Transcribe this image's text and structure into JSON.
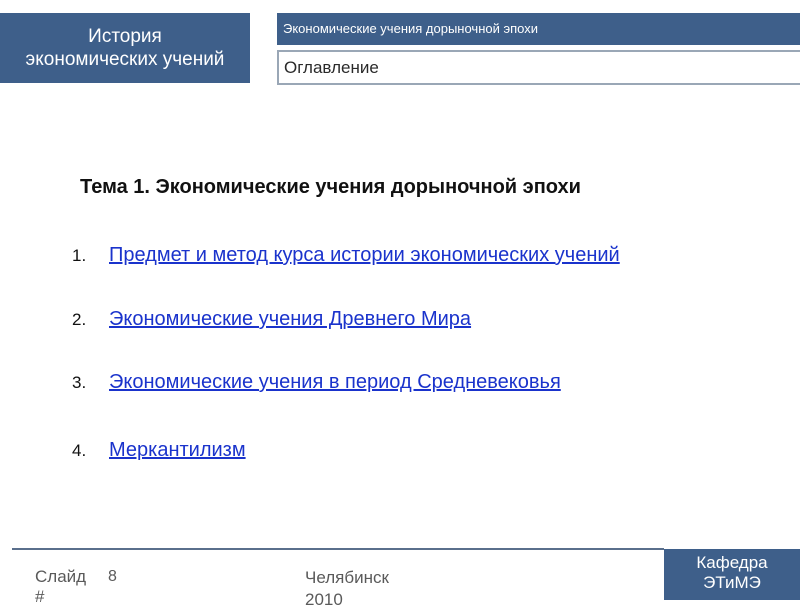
{
  "header": {
    "course_title_line1": "История",
    "course_title_line2": "экономических учений",
    "section_title": "Экономические учения дорыночной эпохи",
    "subsection_title": "Оглавление"
  },
  "main": {
    "topic_title": "Тема 1. Экономические учения дорыночной эпохи",
    "items": [
      {
        "number": "1.",
        "label": "Предмет и метод курса истории экономических учений"
      },
      {
        "number": "2.",
        "label": "Экономические учения Древнего Мира"
      },
      {
        "number": "3.",
        "label": "Экономические учения в период  Средневековья"
      },
      {
        "number": "4.",
        "label": "Меркантилизм"
      }
    ]
  },
  "footer": {
    "slide_label": "Слайд #",
    "slide_number": "8",
    "city_year": "Челябинск 2010",
    "department_line1": "Кафедра",
    "department_line2": "ЭТиМЭ"
  },
  "colors": {
    "accent": "#3e5f8a",
    "link": "#1a33cc",
    "border": "#9aa7b6"
  }
}
